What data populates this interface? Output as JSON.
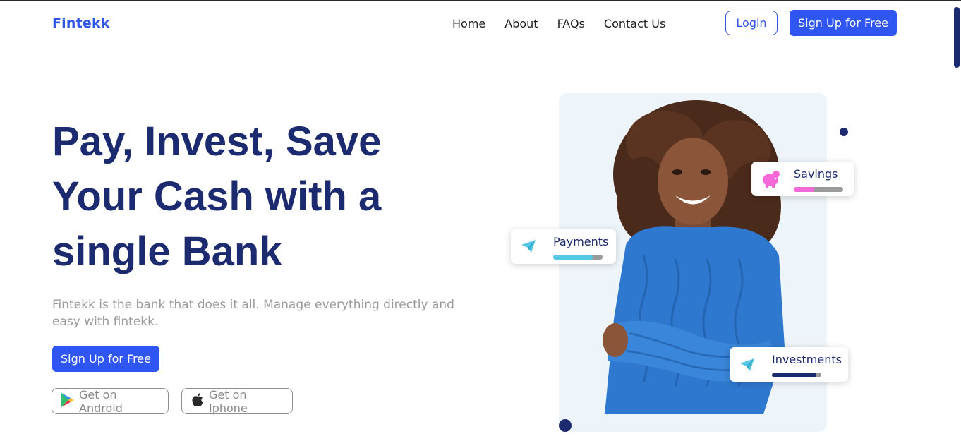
{
  "nav": {
    "brand": "Fintekk",
    "links": [
      "Home",
      "About",
      "FAQs",
      "Contact Us"
    ],
    "login_label": "Login",
    "signup_label": "Sign Up for Free"
  },
  "hero": {
    "title_lines": [
      "Pay, Invest, Save",
      "Your Cash with a",
      "single Bank"
    ],
    "subtitle": "Fintekk is the bank that does it all. Manage everything directly and easy with fintekk.",
    "signup_label": "Sign Up for Free",
    "android_label": "Get on Android",
    "iphone_label": "Get on Iphone"
  },
  "cards": {
    "savings": {
      "label": "Savings",
      "icon": "piggy-bank-icon",
      "progress": 0.42,
      "color": "#f468d8"
    },
    "payments": {
      "label": "Payments",
      "icon": "paper-plane-icon",
      "progress": 0.8,
      "color": "#56c6e6"
    },
    "investments": {
      "label": "Investments",
      "icon": "paper-plane-icon",
      "progress": 0.9,
      "color": "#1c2a70"
    }
  },
  "colors": {
    "accent": "#2f56f2",
    "navy": "#1c2a70",
    "muted_text": "#9a9a9a",
    "panel_bg": "#eef5fa",
    "sweater": "#2f78cf"
  }
}
